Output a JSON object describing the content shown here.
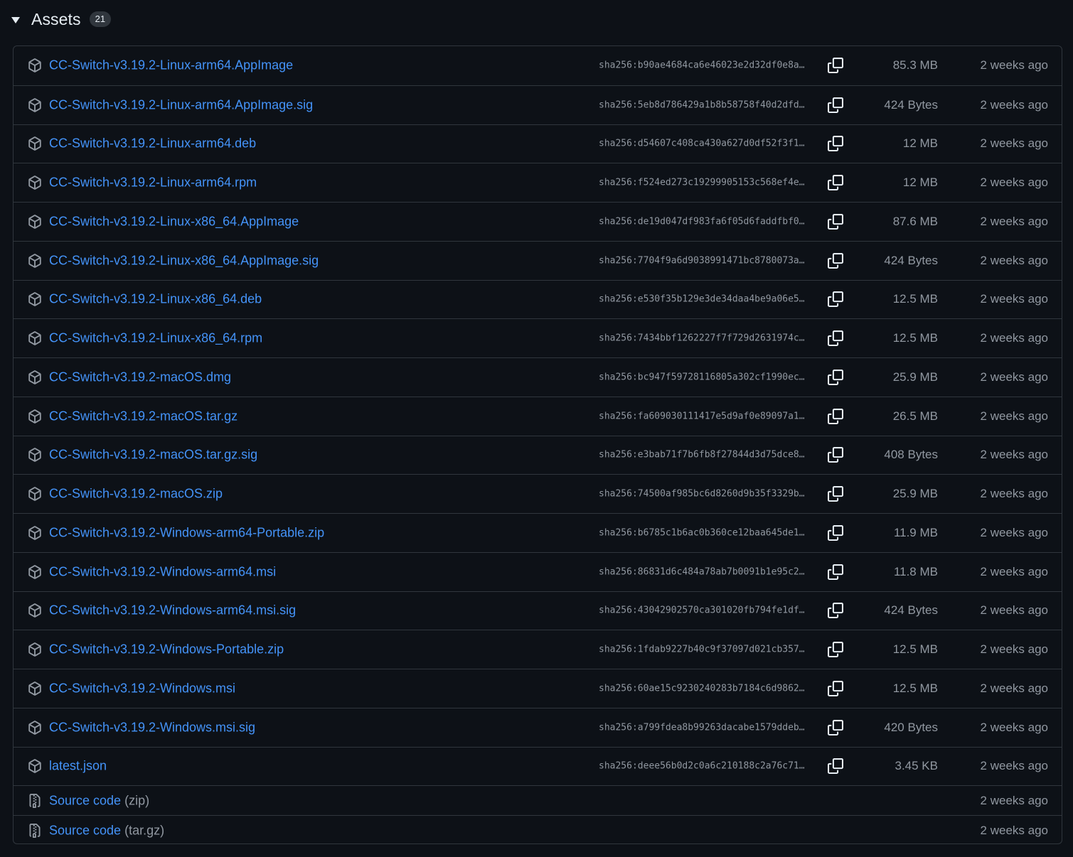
{
  "header": {
    "title": "Assets",
    "count": "21"
  },
  "assets": [
    {
      "name": "CC-Switch-v3.19.2-Linux-arm64.AppImage",
      "sha": "sha256:b90ae4684ca6e46023e2d32df0e8a…",
      "size": "85.3 MB",
      "date": "2 weeks ago"
    },
    {
      "name": "CC-Switch-v3.19.2-Linux-arm64.AppImage.sig",
      "sha": "sha256:5eb8d786429a1b8b58758f40d2dfd…",
      "size": "424 Bytes",
      "date": "2 weeks ago"
    },
    {
      "name": "CC-Switch-v3.19.2-Linux-arm64.deb",
      "sha": "sha256:d54607c408ca430a627d0df52f3f1…",
      "size": "12 MB",
      "date": "2 weeks ago"
    },
    {
      "name": "CC-Switch-v3.19.2-Linux-arm64.rpm",
      "sha": "sha256:f524ed273c19299905153c568ef4e…",
      "size": "12 MB",
      "date": "2 weeks ago"
    },
    {
      "name": "CC-Switch-v3.19.2-Linux-x86_64.AppImage",
      "sha": "sha256:de19d047df983fa6f05d6faddfbf0…",
      "size": "87.6 MB",
      "date": "2 weeks ago"
    },
    {
      "name": "CC-Switch-v3.19.2-Linux-x86_64.AppImage.sig",
      "sha": "sha256:7704f9a6d9038991471bc8780073a…",
      "size": "424 Bytes",
      "date": "2 weeks ago"
    },
    {
      "name": "CC-Switch-v3.19.2-Linux-x86_64.deb",
      "sha": "sha256:e530f35b129e3de34daa4be9a06e5…",
      "size": "12.5 MB",
      "date": "2 weeks ago"
    },
    {
      "name": "CC-Switch-v3.19.2-Linux-x86_64.rpm",
      "sha": "sha256:7434bbf1262227f7f729d2631974c…",
      "size": "12.5 MB",
      "date": "2 weeks ago"
    },
    {
      "name": "CC-Switch-v3.19.2-macOS.dmg",
      "sha": "sha256:bc947f59728116805a302cf1990ec…",
      "size": "25.9 MB",
      "date": "2 weeks ago"
    },
    {
      "name": "CC-Switch-v3.19.2-macOS.tar.gz",
      "sha": "sha256:fa609030111417e5d9af0e89097a1…",
      "size": "26.5 MB",
      "date": "2 weeks ago"
    },
    {
      "name": "CC-Switch-v3.19.2-macOS.tar.gz.sig",
      "sha": "sha256:e3bab71f7b6fb8f27844d3d75dce8…",
      "size": "408 Bytes",
      "date": "2 weeks ago"
    },
    {
      "name": "CC-Switch-v3.19.2-macOS.zip",
      "sha": "sha256:74500af985bc6d8260d9b35f3329b…",
      "size": "25.9 MB",
      "date": "2 weeks ago"
    },
    {
      "name": "CC-Switch-v3.19.2-Windows-arm64-Portable.zip",
      "sha": "sha256:b6785c1b6ac0b360ce12baa645de1…",
      "size": "11.9 MB",
      "date": "2 weeks ago"
    },
    {
      "name": "CC-Switch-v3.19.2-Windows-arm64.msi",
      "sha": "sha256:86831d6c484a78ab7b0091b1e95c2…",
      "size": "11.8 MB",
      "date": "2 weeks ago"
    },
    {
      "name": "CC-Switch-v3.19.2-Windows-arm64.msi.sig",
      "sha": "sha256:43042902570ca301020fb794fe1df…",
      "size": "424 Bytes",
      "date": "2 weeks ago"
    },
    {
      "name": "CC-Switch-v3.19.2-Windows-Portable.zip",
      "sha": "sha256:1fdab9227b40c9f37097d021cb357…",
      "size": "12.5 MB",
      "date": "2 weeks ago"
    },
    {
      "name": "CC-Switch-v3.19.2-Windows.msi",
      "sha": "sha256:60ae15c9230240283b7184c6d9862…",
      "size": "12.5 MB",
      "date": "2 weeks ago"
    },
    {
      "name": "CC-Switch-v3.19.2-Windows.msi.sig",
      "sha": "sha256:a799fdea8b99263dacabe1579ddeb…",
      "size": "420 Bytes",
      "date": "2 weeks ago"
    },
    {
      "name": "latest.json",
      "sha": "sha256:deee56b0d2c0a6c210188c2a76c71…",
      "size": "3.45 KB",
      "date": "2 weeks ago"
    }
  ],
  "source": [
    {
      "label": "Source code",
      "format": "(zip)",
      "date": "2 weeks ago"
    },
    {
      "label": "Source code",
      "format": "(tar.gz)",
      "date": "2 weeks ago"
    }
  ],
  "icons": {
    "row": "package-icon",
    "source": "file-zip-icon",
    "copy": "copy-icon",
    "toggle": "triangle-down-icon"
  },
  "colors": {
    "background": "#0d1117",
    "border": "#30363d",
    "link": "#4493f8",
    "muted": "#9198a1",
    "text": "#e6edf3"
  }
}
